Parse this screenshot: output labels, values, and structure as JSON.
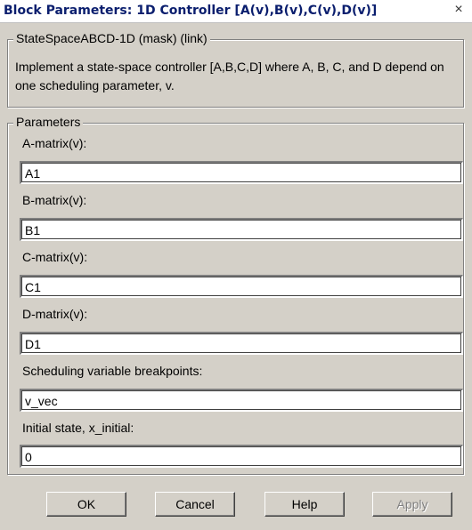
{
  "window": {
    "title": "Block Parameters: 1D Controller [A(v),B(v),C(v),D(v)]",
    "close_glyph": "×"
  },
  "mask": {
    "legend": "StateSpaceABCD-1D (mask) (link)",
    "description": "Implement a state-space controller [A,B,C,D] where A, B, C, and D depend on one scheduling parameter, v."
  },
  "parameters": {
    "legend": "Parameters",
    "fields": [
      {
        "label": "A-matrix(v):",
        "value": "A1"
      },
      {
        "label": "B-matrix(v):",
        "value": "B1"
      },
      {
        "label": "C-matrix(v):",
        "value": "C1"
      },
      {
        "label": "D-matrix(v):",
        "value": "D1"
      },
      {
        "label": "Scheduling variable breakpoints:",
        "value": "v_vec"
      },
      {
        "label": "Initial state, x_initial:",
        "value": "0"
      }
    ]
  },
  "buttons": {
    "ok": "OK",
    "cancel": "Cancel",
    "help": "Help",
    "apply": "Apply"
  }
}
